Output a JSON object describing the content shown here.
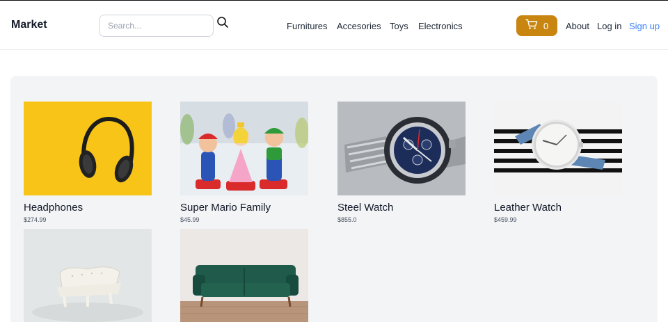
{
  "header": {
    "brand": "Market",
    "search_placeholder": "Search...",
    "nav": [
      "Furnitures",
      "Accesories",
      "Toys",
      "Electronics"
    ],
    "cart_count": "0",
    "about": "About",
    "login": "Log in",
    "signup": "Sign up"
  },
  "products": [
    {
      "name": "Headphones",
      "price": "$274.99"
    },
    {
      "name": "Super Mario Family",
      "price": "$45.99"
    },
    {
      "name": "Steel Watch",
      "price": "$855.0"
    },
    {
      "name": "Leather Watch",
      "price": "$459.99"
    },
    {
      "name": "",
      "price": ""
    },
    {
      "name": "",
      "price": ""
    }
  ],
  "colors": {
    "accent": "#c8850f",
    "signup": "#3b82f6",
    "panel": "#f3f4f6"
  }
}
